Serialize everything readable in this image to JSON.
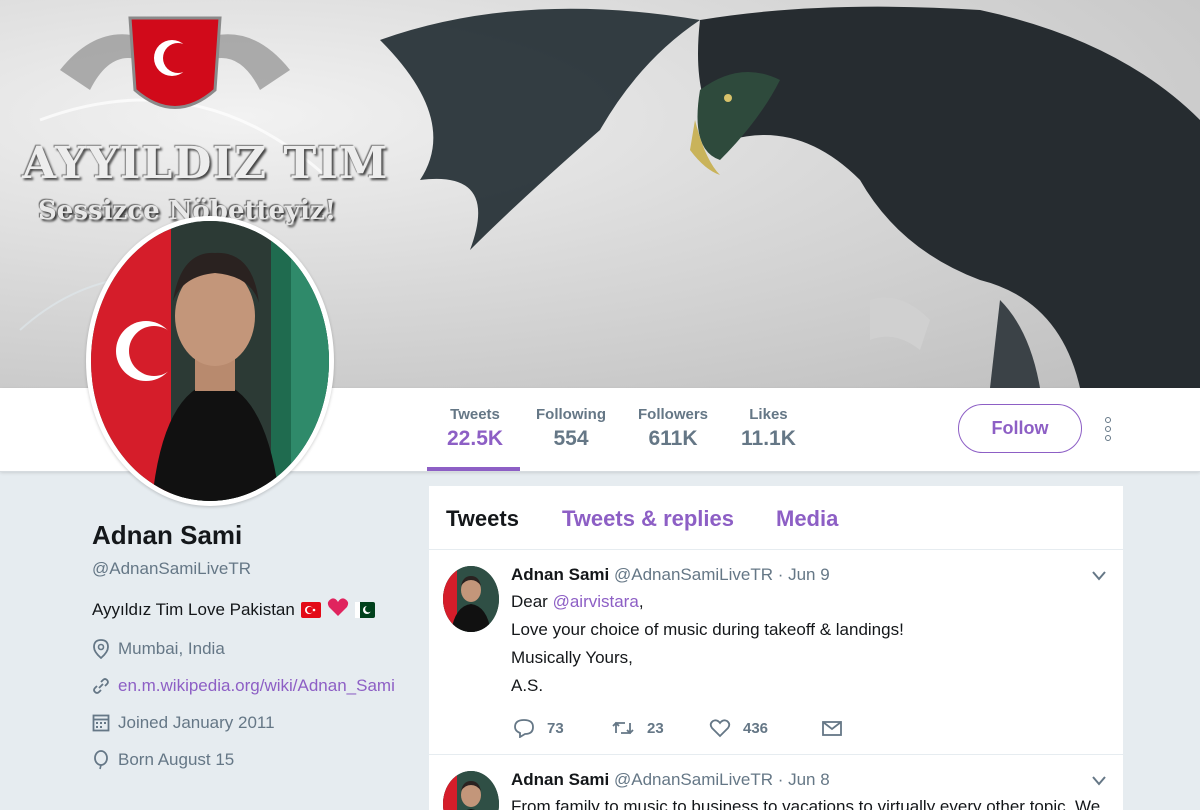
{
  "banner": {
    "title": "AYYILDIZ TIM",
    "slogan": "Sessizce Nöbetteyiz!"
  },
  "stats": [
    {
      "label": "Tweets",
      "value": "22.5K",
      "active": true
    },
    {
      "label": "Following",
      "value": "554",
      "active": false
    },
    {
      "label": "Followers",
      "value": "611K",
      "active": false
    },
    {
      "label": "Likes",
      "value": "11.1K",
      "active": false
    }
  ],
  "follow_label": "Follow",
  "profile": {
    "name": "Adnan Sami",
    "handle": "@AdnanSamiLiveTR",
    "bio": "Ayyıldız Tim Love Pakistan",
    "location": "Mumbai, India",
    "website": "en.m.wikipedia.org/wiki/Adnan_Sami",
    "joined": "Joined January 2011",
    "born": "Born August 15"
  },
  "timeline": {
    "tabs": [
      {
        "label": "Tweets",
        "active": true
      },
      {
        "label": "Tweets & replies",
        "active": false
      },
      {
        "label": "Media",
        "active": false
      }
    ],
    "tweets": [
      {
        "name": "Adnan Sami",
        "handle": "@AdnanSamiLiveTR",
        "date": "· Jun 9",
        "greeting": "Dear ",
        "mention": "@airvistara",
        "greeting_end": ",",
        "line2": "Love your choice of music during takeoff & landings!",
        "line3": "Musically Yours,",
        "line4": "A.S.",
        "replies": "73",
        "retweets": "23",
        "likes": "436"
      },
      {
        "name": "Adnan Sami",
        "handle": "@AdnanSamiLiveTR",
        "date": "· Jun 8",
        "line1": "From family to music to business to vacations to virtually every other topic. We"
      }
    ]
  },
  "colors": {
    "accent": "#8d5fc5",
    "text": "#14171a",
    "muted": "#657786",
    "background": "#e6ecf0"
  }
}
